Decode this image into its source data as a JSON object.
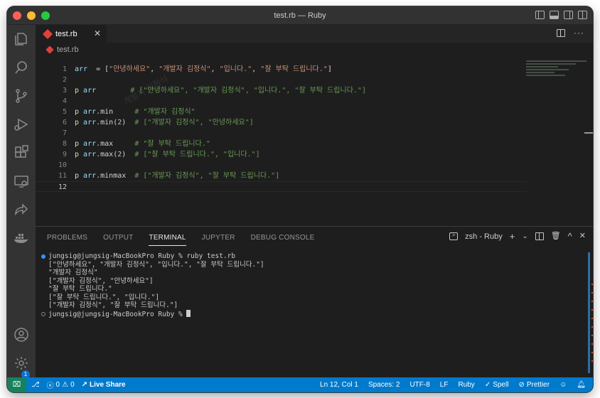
{
  "window": {
    "title": "test.rb — Ruby"
  },
  "tab": {
    "label": "test.rb",
    "close": "✕"
  },
  "tab_actions": {
    "more": "···"
  },
  "breadcrumb": {
    "file": "test.rb"
  },
  "editor": {
    "lines": [
      {
        "n": "1",
        "tokens": [
          [
            "c-var",
            "arr"
          ],
          [
            "",
            "  = ["
          ],
          [
            "c-str",
            "\"안녕하세요\""
          ],
          [
            "",
            ", "
          ],
          [
            "c-str",
            "\"개발자 김정식\""
          ],
          [
            "",
            ", "
          ],
          [
            "c-str",
            "\"입니다.\""
          ],
          [
            "",
            ", "
          ],
          [
            "c-str",
            "\"잘 부탁 드립니다.\""
          ],
          [
            "",
            "]"
          ]
        ]
      },
      {
        "n": "2",
        "tokens": []
      },
      {
        "n": "3",
        "tokens": [
          [
            "c-fn",
            "p"
          ],
          [
            "",
            ""
          ],
          [
            "c-var",
            " arr"
          ],
          [
            "",
            "        "
          ],
          [
            "c-com",
            "# [\"안녕하세요\", \"개발자 김정식\", \"입니다.\", \"잘 부탁 드립니다.\"]"
          ]
        ]
      },
      {
        "n": "4",
        "tokens": []
      },
      {
        "n": "5",
        "tokens": [
          [
            "c-fn",
            "p"
          ],
          [
            "c-var",
            " arr"
          ],
          [
            "",
            ".min     "
          ],
          [
            "c-com",
            "# \"개발자 김정식\""
          ]
        ]
      },
      {
        "n": "6",
        "tokens": [
          [
            "c-fn",
            "p"
          ],
          [
            "c-var",
            " arr"
          ],
          [
            "",
            ".min("
          ],
          [
            "c-num",
            "2"
          ],
          [
            "",
            ")  "
          ],
          [
            "c-com",
            "# [\"개발자 김정식\", \"안녕하세요\"]"
          ]
        ]
      },
      {
        "n": "7",
        "tokens": []
      },
      {
        "n": "8",
        "tokens": [
          [
            "c-fn",
            "p"
          ],
          [
            "c-var",
            " arr"
          ],
          [
            "",
            ".max     "
          ],
          [
            "c-com",
            "# \"잘 부탁 드립니다.\""
          ]
        ]
      },
      {
        "n": "9",
        "tokens": [
          [
            "c-fn",
            "p"
          ],
          [
            "c-var",
            " arr"
          ],
          [
            "",
            ".max("
          ],
          [
            "c-num",
            "2"
          ],
          [
            "",
            ")  "
          ],
          [
            "c-com",
            "# [\"잘 부탁 드립니다.\", \"입니다.\"]"
          ]
        ]
      },
      {
        "n": "10",
        "tokens": []
      },
      {
        "n": "11",
        "tokens": [
          [
            "c-fn",
            "p"
          ],
          [
            "c-var",
            " arr"
          ],
          [
            "",
            ".minmax  "
          ],
          [
            "c-com",
            "# [\"개발자 김정식\", \"잘 부탁 드립니다.\"]"
          ]
        ]
      },
      {
        "n": "12",
        "tokens": []
      }
    ],
    "ghost_text": "개발자 김정식"
  },
  "panel": {
    "tabs": [
      "PROBLEMS",
      "OUTPUT",
      "TERMINAL",
      "JUPYTER",
      "DEBUG CONSOLE"
    ],
    "active_tab": "TERMINAL",
    "terminal_name": "zsh - Ruby",
    "add": "+",
    "chevron": "⌄",
    "maximize": "^",
    "close": "✕"
  },
  "terminal": {
    "lines": [
      "jungsig@jungsig-MacBookPro Ruby % ruby test.rb",
      "[\"안녕하세요\", \"개발자 김정식\", \"입니다.\", \"잘 부탁 드립니다.\"]",
      "\"개발자 김정식\"",
      "[\"개발자 김정식\", \"안녕하세요\"]",
      "\"잘 부탁 드립니다.\"",
      "[\"잘 부탁 드립니다.\", \"입니다.\"]",
      "[\"개발자 김정식\", \"잘 부탁 드립니다.\"]",
      "jungsig@jungsig-MacBookPro Ruby % "
    ]
  },
  "statusbar": {
    "remote": "⌧",
    "git": "⎇",
    "errors": "0",
    "warnings": "0",
    "live_share": "Live Share",
    "position": "Ln 12, Col 1",
    "spaces": "Spaces: 2",
    "encoding": "UTF-8",
    "eol": "LF",
    "language": "Ruby",
    "spell": "Spell",
    "prettier": "Prettier"
  },
  "activity_badge": "1",
  "colors": {
    "accent": "#007acc",
    "remote": "#16825d",
    "ruby": "#e0413b"
  }
}
